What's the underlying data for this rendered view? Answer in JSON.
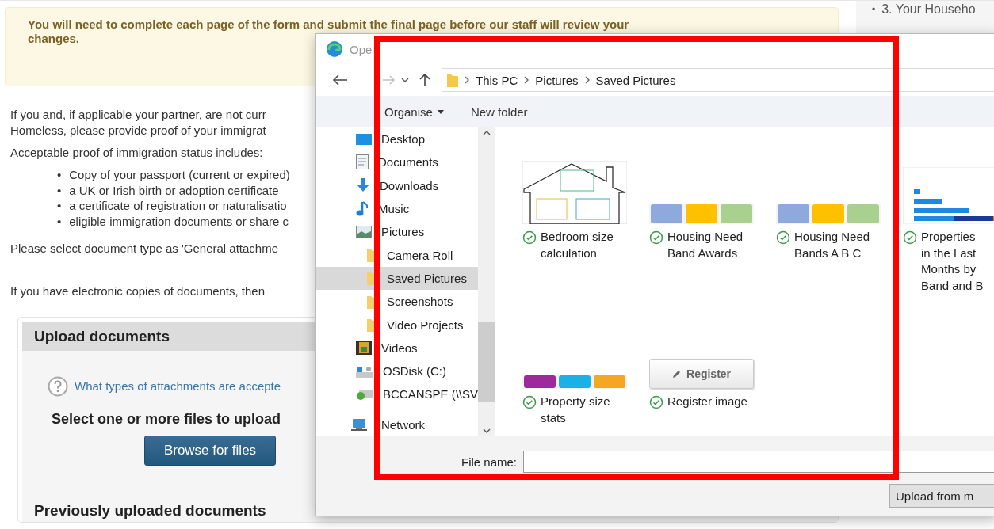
{
  "page": {
    "notice": "You will need to complete each page of the form and submit the final page before our staff will review your\nchanges.",
    "paragraph_1": [
      "If you and, if applicable your partner, are not curr",
      "Homeless, please provide proof of your immigrat"
    ],
    "paragraph_2": "Acceptable proof of immigration status includes:",
    "proof_list": {
      "marker": "•",
      "items": [
        "Copy of your passport (current or expired)",
        "a UK or Irish birth or adoption certificate",
        "a certificate of registration or naturalisatio",
        "eligible immigration documents or share c"
      ]
    },
    "paragraph_3": "Please select document type as 'General attachme",
    "paragraph_4": "If you have electronic copies of documents, then",
    "upload_panel": {
      "title": "Upload documents",
      "help_link": "What types of attachments are accepte",
      "prompt": "Select one or more files to upload",
      "browse_button": "Browse for files",
      "previous_title": "Previously uploaded documents"
    },
    "side_steps": [
      {
        "marker": "•",
        "label": "3. Your Househo"
      }
    ]
  },
  "dialog": {
    "title": "Ope",
    "address": [
      "This PC",
      "Pictures",
      "Saved Pictures"
    ],
    "toolbar": {
      "organise": "Organise",
      "new_folder": "New folder"
    },
    "nav_pane": {
      "items": [
        {
          "label": "Desktop",
          "kind": "desktop",
          "selected": false
        },
        {
          "label": "Documents",
          "kind": "documents",
          "selected": false
        },
        {
          "label": "Downloads",
          "kind": "downloads",
          "selected": false
        },
        {
          "label": "Music",
          "kind": "music",
          "selected": false
        },
        {
          "label": "Pictures",
          "kind": "pictures",
          "selected": false,
          "children": [
            {
              "label": "Camera Roll",
              "kind": "folder",
              "selected": false
            },
            {
              "label": "Saved Pictures",
              "kind": "folder",
              "selected": true
            },
            {
              "label": "Screenshots",
              "kind": "folder",
              "selected": false
            },
            {
              "label": "Video Projects",
              "kind": "folder",
              "selected": false
            }
          ]
        },
        {
          "label": "Videos",
          "kind": "videos",
          "selected": false
        },
        {
          "label": "OSDisk (C:)",
          "kind": "disk",
          "selected": false
        },
        {
          "label": "BCCANSPE (\\\\SV",
          "kind": "network-drive",
          "selected": false
        }
      ],
      "network_item": {
        "label": "Network",
        "kind": "network",
        "selected": false
      }
    },
    "files": [
      {
        "label": "Bedroom size\ncalculation",
        "kind": "house",
        "synced": true
      },
      {
        "label": "Housing Need\nBand Awards",
        "kind": "bands",
        "synced": true
      },
      {
        "label": "Housing Need\nBands A B C",
        "kind": "bands",
        "synced": true
      },
      {
        "label": "Properties\nin the Last\nMonths by\nBand and B",
        "kind": "chart",
        "synced": true
      },
      {
        "label": "Property size\nstats",
        "kind": "stats",
        "synced": true
      },
      {
        "label": "Register image",
        "kind": "button",
        "thumb_text": "Register",
        "synced": true
      }
    ],
    "file_name_label": "File name:",
    "upload_button": "Upload from m"
  },
  "highlight_frame": {
    "shown": true
  }
}
